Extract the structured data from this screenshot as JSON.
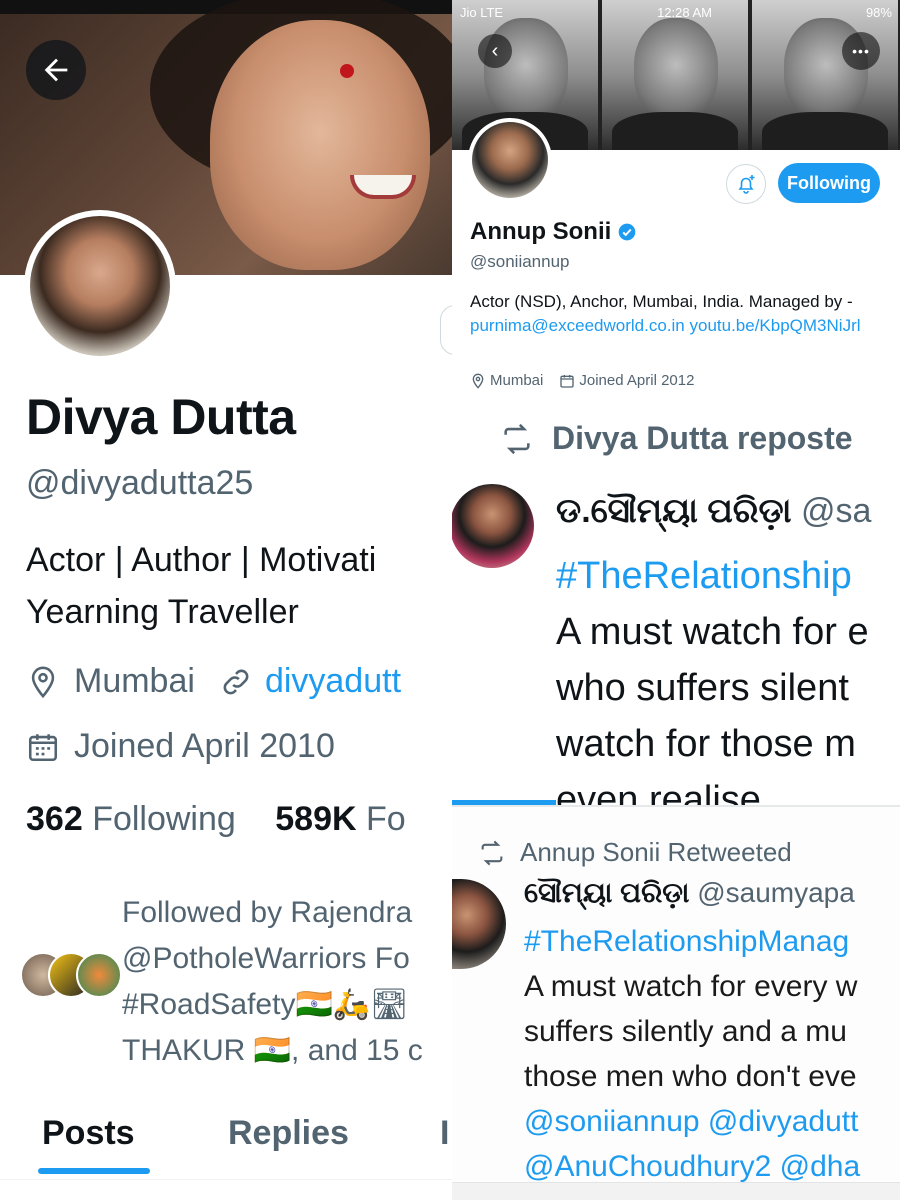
{
  "left_profile": {
    "name": "Divya Dutta",
    "handle": "@divyadutta25",
    "bio_line1": "Actor | Author | Motivati",
    "bio_line2": "Yearning Traveller",
    "location": "Mumbai",
    "website": "divyadutt",
    "joined": "Joined April 2010",
    "following_count": "362",
    "following_label": "Following",
    "followers_count": "589K",
    "followers_label": "Fo",
    "followed_by_lines": [
      "Followed by Rajendra",
      "@PotholeWarriors Fo",
      "#RoadSafety🇮🇳🛵🛣",
      "THAKUR 🇮🇳, and 15 c"
    ],
    "tabs": [
      "Posts",
      "Replies",
      "I"
    ]
  },
  "right_profile": {
    "status_left": "Jio  LTE",
    "status_time": "12:28 AM",
    "status_right": "98%",
    "following_button": "Following",
    "name": "Annup Sonii",
    "handle": "@soniiannup",
    "bio_text": "Actor (NSD), Anchor, Mumbai, India. Managed by - ",
    "bio_email": "purnima@exceedworld.co.in",
    "bio_link": "youtu.be/KbpQM3NiJrl",
    "location": "Mumbai",
    "joined": "Joined April 2012"
  },
  "repost_post": {
    "repost_label": "Divya Dutta reposte",
    "author_name": "ଡ.ସୌମ୍ୟା ପରିଡ଼ା",
    "author_handle": "@sa",
    "hashtag": "#TheRelationship",
    "line1": "A must watch for e",
    "line2": "who suffers silent",
    "line3": "watch for those m",
    "line4": "even realise"
  },
  "retweet_post": {
    "retweet_label": "Annup Sonii Retweeted",
    "author_name": "ସୌମ୍ୟା ପରିଡ଼ା",
    "author_handle": "@saumyapa",
    "hashtag": "#TheRelationshipManag",
    "line1": "A must watch for every w",
    "line2": "suffers silently and a mu",
    "line3": "those men who don't eve",
    "mentions1": "@soniiannup @divyadutt",
    "mentions2": "@AnuChoudhury2 @dha"
  },
  "icons": [
    "back-arrow-icon",
    "location-icon",
    "link-icon",
    "calendar-icon",
    "bell-add-icon",
    "verified-icon",
    "more-icon",
    "retweet-icon"
  ],
  "colors": {
    "accent": "#1d9bf0",
    "secondary_text": "#536471",
    "primary_text": "#0f1419"
  }
}
